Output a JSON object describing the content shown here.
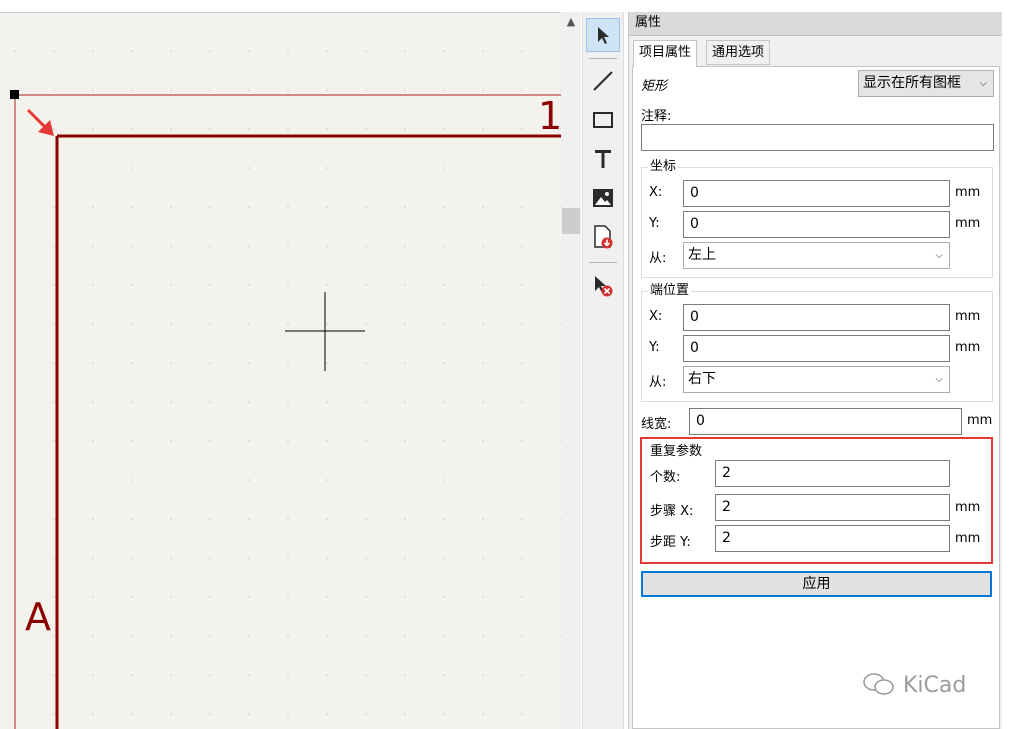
{
  "canvas": {
    "frame_column_label": "1",
    "frame_row_label": "A"
  },
  "toolbar": {
    "tools": [
      "select-tool",
      "line-tool",
      "rectangle-tool",
      "text-tool",
      "image-tool",
      "import-tool",
      "delete-tool"
    ]
  },
  "panel": {
    "title": "属性",
    "tabs": [
      "项目属性",
      "通用选项"
    ],
    "item_type": "矩形",
    "display_select": "显示在所有图框",
    "comment_label": "注释:",
    "comment_value": "",
    "start": {
      "title": "坐标",
      "x_label": "X:",
      "x_value": "0",
      "y_label": "Y:",
      "y_value": "0",
      "from_label": "从:",
      "from_value": "左上"
    },
    "end": {
      "title": "端位置",
      "x_label": "X:",
      "x_value": "0",
      "y_label": "Y:",
      "y_value": "0",
      "from_label": "从:",
      "from_value": "右下"
    },
    "line_width_label": "线宽:",
    "line_width_value": "0",
    "unit": "mm",
    "repeat": {
      "title": "重复参数",
      "count_label": "个数:",
      "count_value": "2",
      "step_x_label": "步骤 X:",
      "step_x_value": "2",
      "step_y_label": "步距 Y:",
      "step_y_value": "2"
    },
    "apply_label": "应用"
  },
  "watermark": "KiCad",
  "colors": {
    "frame": "#8b0000",
    "frame_light": "#d08a8a",
    "highlight": "#e53935",
    "accent": "#0078d7"
  }
}
